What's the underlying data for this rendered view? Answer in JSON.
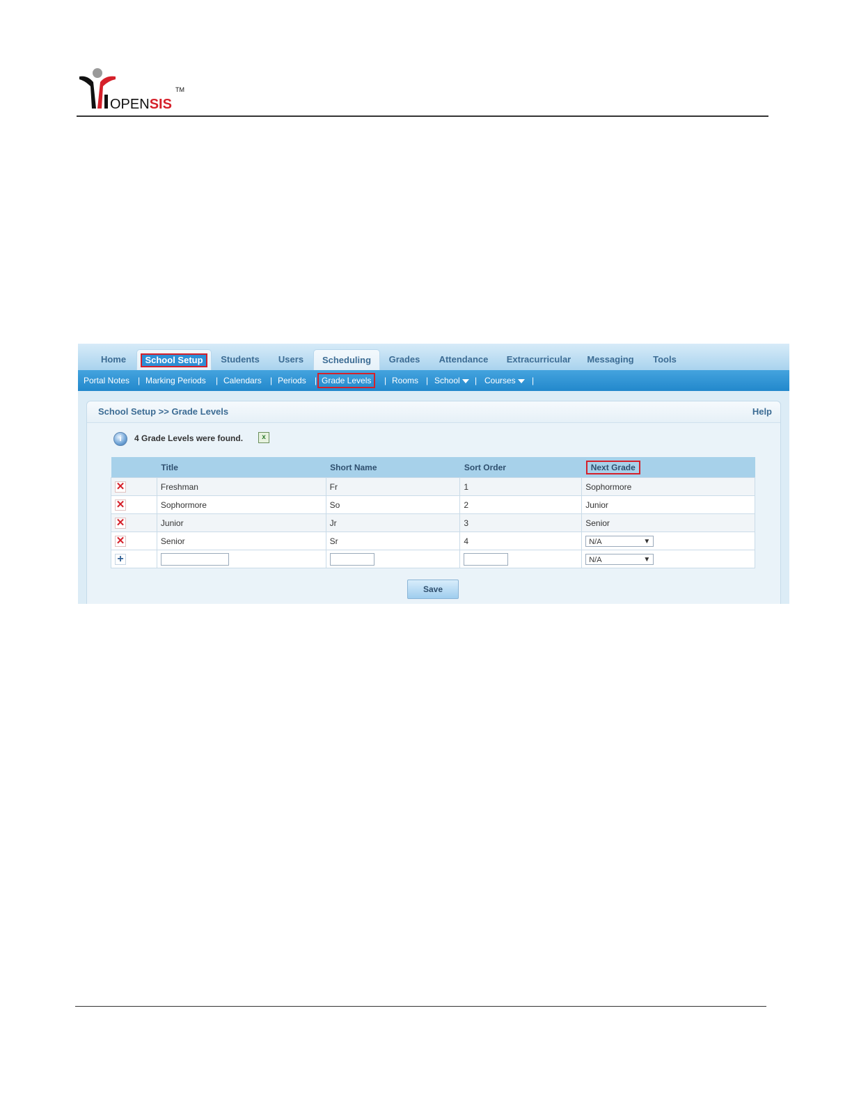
{
  "logo": {
    "brand_text": "OPENSIS",
    "tm": "TM"
  },
  "topnav": {
    "tabs": [
      "Home",
      "School Setup",
      "Students",
      "Users",
      "Scheduling",
      "Grades",
      "Attendance",
      "Extracurricular",
      "Messaging",
      "Tools"
    ],
    "highlighted": "School Setup",
    "active": "Scheduling"
  },
  "subnav": {
    "items": [
      "Portal Notes",
      "Marking Periods",
      "Calendars",
      "Periods",
      "Grade Levels",
      "Rooms",
      "School",
      "Courses"
    ],
    "highlighted": "Grade Levels",
    "separator": "|"
  },
  "breadcrumb": "School Setup >> Grade Levels",
  "help_label": "Help",
  "info_message": "4 Grade Levels were found.",
  "info_icon": "info-icon",
  "export_icon": "excel-export-icon",
  "table": {
    "headers": [
      "Title",
      "Short Name",
      "Sort Order",
      "Next Grade"
    ],
    "rows": [
      {
        "title": "Freshman",
        "short": "Fr",
        "order": "1",
        "next": "Sophormore"
      },
      {
        "title": "Sophormore",
        "short": "So",
        "order": "2",
        "next": "Junior"
      },
      {
        "title": "Junior",
        "short": "Jr",
        "order": "3",
        "next": "Senior"
      },
      {
        "title": "Senior",
        "short": "Sr",
        "order": "4",
        "next": "N/A"
      }
    ],
    "new_row": {
      "title": "",
      "short": "",
      "order": "",
      "next": "N/A"
    }
  },
  "save_label": "Save",
  "colors": {
    "highlight": "#d5202a",
    "nav": "#2288cc",
    "header": "#a7d1ea"
  }
}
